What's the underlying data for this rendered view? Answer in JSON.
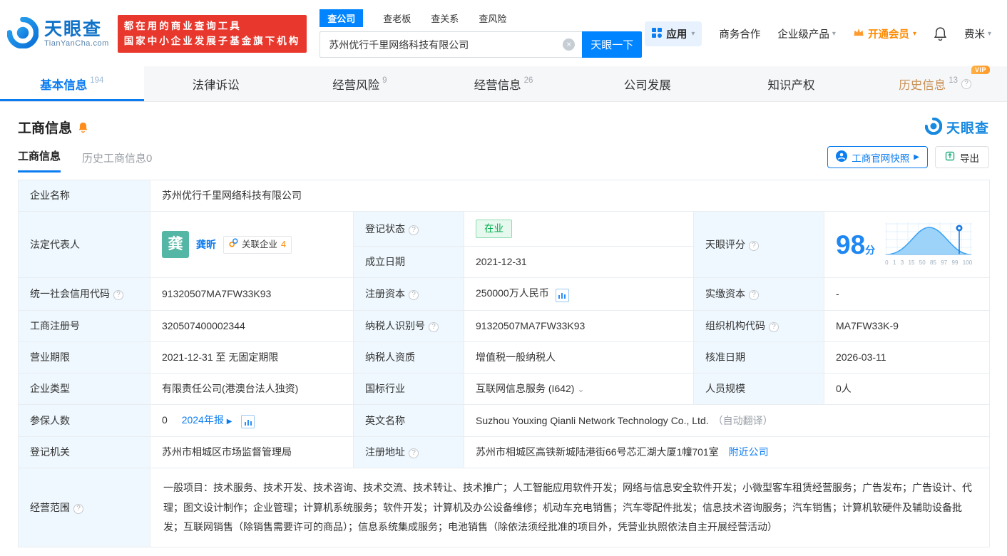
{
  "brand": {
    "name": "天眼查",
    "domain": "TianYanCha.com",
    "banner_line1": "都在用的商业查询工具",
    "banner_line2": "国家中小企业发展子基金旗下机构"
  },
  "icons": {
    "help": "?",
    "caret": "▾",
    "clear": "×",
    "arrow": "▶",
    "chevron": "⌄"
  },
  "search": {
    "tabs": [
      {
        "label": "查公司"
      },
      {
        "label": "查老板"
      },
      {
        "label": "查关系"
      },
      {
        "label": "查风险"
      }
    ],
    "value": "苏州优行千里网络科技有限公司",
    "button_label": "天眼一下"
  },
  "top_menu": {
    "apps_label": "应用",
    "cooperation_label": "商务合作",
    "enterprise_label": "企业级产品",
    "vip_label": "开通会员",
    "user_label": "费米"
  },
  "nav_tabs": [
    {
      "label": "基本信息",
      "count": "194"
    },
    {
      "label": "法律诉讼",
      "count": ""
    },
    {
      "label": "经营风险",
      "count": "9"
    },
    {
      "label": "经营信息",
      "count": "26"
    },
    {
      "label": "公司发展",
      "count": ""
    },
    {
      "label": "知识产权",
      "count": ""
    },
    {
      "label": "历史信息",
      "count": "13",
      "badge": "VIP"
    }
  ],
  "section": {
    "title": "工商信息",
    "subtab_active": "工商信息",
    "subtab_history": "历史工商信息0",
    "snapshot_button": "工商官网快照",
    "export_button": "导出"
  },
  "score": {
    "label": "天眼评分",
    "value": "98",
    "unit": "分",
    "axis": [
      "0",
      "1",
      "3",
      "15",
      "50",
      "85",
      "97",
      "99",
      "100"
    ]
  },
  "fields": {
    "company_name_label": "企业名称",
    "company_name": "苏州优行千里网络科技有限公司",
    "legal_rep_label": "法定代表人",
    "legal_rep_avatar": "龚",
    "legal_rep_name": "龚昕",
    "related_label": "关联企业",
    "related_count": "4",
    "reg_status_label": "登记状态",
    "reg_status": "在业",
    "establish_date_label": "成立日期",
    "establish_date": "2021-12-31",
    "credit_code_label": "统一社会信用代码",
    "credit_code": "91320507MA7FW33K93",
    "reg_capital_label": "注册资本",
    "reg_capital": "250000万人民币",
    "paid_capital_label": "实缴资本",
    "paid_capital": "-",
    "reg_number_label": "工商注册号",
    "reg_number": "320507400002344",
    "taxpayer_id_label": "纳税人识别号",
    "taxpayer_id": "91320507MA7FW33K93",
    "org_code_label": "组织机构代码",
    "org_code": "MA7FW33K-9",
    "business_term_label": "营业期限",
    "business_term": "2021-12-31 至 无固定期限",
    "taxpayer_quality_label": "纳税人资质",
    "taxpayer_quality": "增值税一般纳税人",
    "approval_date_label": "核准日期",
    "approval_date": "2026-03-11",
    "company_type_label": "企业类型",
    "company_type": "有限责任公司(港澳台法人独资)",
    "industry_label": "国标行业",
    "industry": "互联网信息服务 (I642)",
    "staff_size_label": "人员规模",
    "staff_size": "0人",
    "insured_label": "参保人数",
    "insured_value": "0",
    "insured_report": "2024年报",
    "english_name_label": "英文名称",
    "english_name": "Suzhou Youxing Qianli Network Technology Co., Ltd.",
    "english_name_note": "（自动翻译）",
    "registry_label": "登记机关",
    "registry": "苏州市相城区市场监督管理局",
    "address_label": "注册地址",
    "address": "苏州市相城区高铁新城陆港街66号芯汇湖大厦1幢701室",
    "address_link": "附近公司",
    "business_scope_label": "经营范围",
    "business_scope": "一般项目：技术服务、技术开发、技术咨询、技术交流、技术转让、技术推广；人工智能应用软件开发；网络与信息安全软件开发；小微型客车租赁经营服务；广告发布；广告设计、代理；图文设计制作；企业管理；计算机系统服务；软件开发；计算机及办公设备维修；机动车充电销售；汽车零配件批发；信息技术咨询服务；汽车销售；计算机软硬件及辅助设备批发；互联网销售（除销售需要许可的商品）；信息系统集成服务；电池销售（除依法须经批准的项目外，凭营业执照依法自主开展经营活动）"
  }
}
